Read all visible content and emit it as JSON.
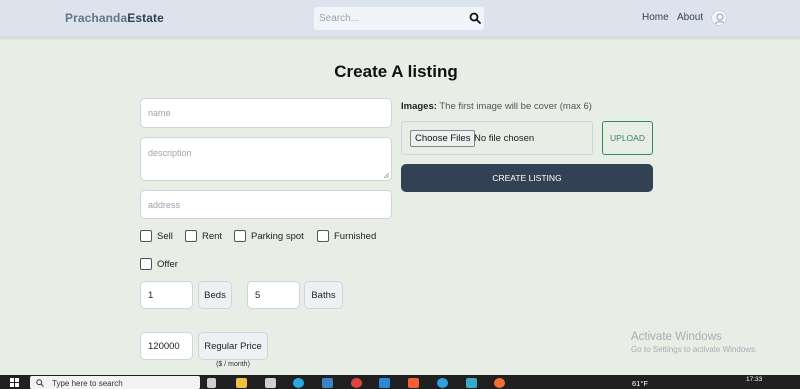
{
  "header": {
    "logo_part1": "Prachanda",
    "logo_part2": "Estate",
    "search_placeholder": "Search...",
    "nav": {
      "home": "Home",
      "about": "About"
    }
  },
  "page": {
    "title": "Create A listing"
  },
  "form": {
    "name_placeholder": "name",
    "description_placeholder": "description",
    "address_placeholder": "address",
    "checkboxes": [
      {
        "label": "Sell",
        "checked": false
      },
      {
        "label": "Rent",
        "checked": false
      },
      {
        "label": "Parking spot",
        "checked": false
      },
      {
        "label": "Furnished",
        "checked": false
      },
      {
        "label": "Offer",
        "checked": false
      }
    ],
    "beds": {
      "value": "1",
      "label": "Beds"
    },
    "baths": {
      "value": "5",
      "label": "Baths"
    },
    "price": {
      "value": "120000",
      "label": "Regular Price",
      "sub": "($ / month)"
    }
  },
  "images": {
    "label_bold": "Images:",
    "label_text": "The first image will be cover (max 6)",
    "choose_label": "Choose Files",
    "file_status": "No file chosen",
    "upload_label": "UPLOAD"
  },
  "create_button": "CREATE LISTING",
  "watermark": {
    "line1": "Activate Windows",
    "line2": "Go to Settings to activate Windows."
  },
  "taskbar": {
    "search_text": "Type here to search",
    "weather": "61°F",
    "time": "17:33"
  },
  "colors": {
    "page_bg": "#e8ede6",
    "header_bg": "#dde3ec",
    "primary_button": "#334155",
    "upload_accent": "#2e8b57"
  }
}
